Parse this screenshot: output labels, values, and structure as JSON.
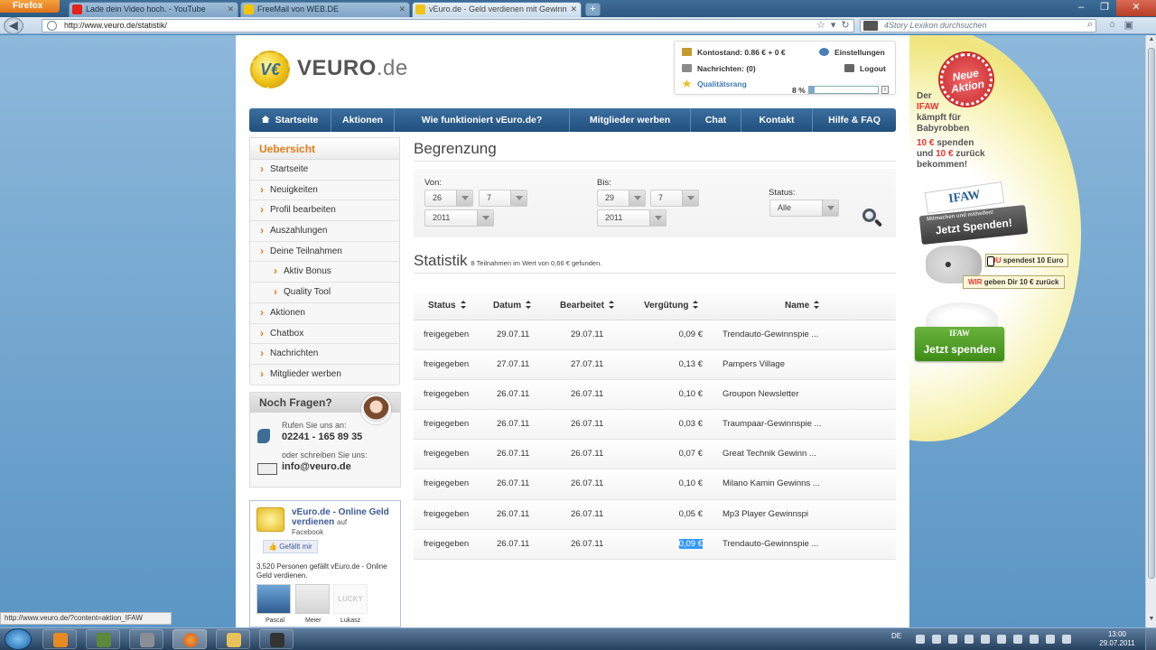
{
  "browser": {
    "app_button": "Firefox",
    "tabs": [
      {
        "label": "Lade dein Video hoch. - YouTube",
        "favicon_color": "#e62117"
      },
      {
        "label": "FreeMail von WEB.DE",
        "favicon_color": "#f5c400"
      },
      {
        "label": "vEuro.de - Geld verdienen mit Gewinn",
        "favicon_color": "#f0c418",
        "active": true
      }
    ],
    "url": "http://www.veuro.de/statistik/",
    "search_placeholder": "4Story Lexikon durchsuchen",
    "status_url": "http://www.veuro.de/?content=aktion_IFAW"
  },
  "site": {
    "logo": {
      "brand": "VEURO",
      "tld": ".de",
      "coin_letter": "V€"
    },
    "account": {
      "balance": "Kontostand: 0.86 € + 0 €",
      "messages": "Nachrichten: (0)",
      "quality_label": "Qualitätsrang",
      "quality_pct": "8 %",
      "quality_value": 0.08,
      "settings": "Einstellungen",
      "logout": "Logout"
    },
    "nav": [
      {
        "label": "Startseite",
        "icon": "home-icon"
      },
      {
        "label": "Aktionen"
      },
      {
        "label": "Wie funktioniert vEuro.de?"
      },
      {
        "label": "Mitglieder werben"
      },
      {
        "label": "Chat"
      },
      {
        "label": "Kontakt"
      },
      {
        "label": "Hilfe & FAQ"
      }
    ],
    "sidebar": {
      "title": "Uebersicht",
      "items": [
        {
          "label": "Startseite"
        },
        {
          "label": "Neuigkeiten"
        },
        {
          "label": "Profil bearbeiten"
        },
        {
          "label": "Auszahlungen"
        },
        {
          "label": "Deine Teilnahmen"
        },
        {
          "label": "Aktiv Bonus",
          "sub": true
        },
        {
          "label": "Quality Tool",
          "sub": true
        },
        {
          "label": "Aktionen"
        },
        {
          "label": "Chatbox"
        },
        {
          "label": "Nachrichten"
        },
        {
          "label": "Mitglieder werben"
        }
      ]
    },
    "help": {
      "title": "Noch Fragen?",
      "call_label": "Rufen Sie uns an:",
      "phone": "02241 - 165 89 35",
      "write_label": "oder schreiben Sie uns:",
      "email": "info@veuro.de"
    },
    "facebook": {
      "page_name": "vEuro.de - Online Geld verdienen",
      "on": "auf",
      "network": "Facebook",
      "like_button": "Gefällt mir",
      "count_text": "3,520 Personen gefällt vEuro.de - Online Geld verdienen.",
      "faces": [
        "Pascal",
        "Meier",
        "Lukasz"
      ],
      "face_overlay": "LUCKY"
    }
  },
  "filter": {
    "heading": "Begrenzung",
    "von_label": "Von:",
    "von_day": "26",
    "von_month": "7",
    "von_year": "2011",
    "bis_label": "Bis:",
    "bis_day": "29",
    "bis_month": "7",
    "bis_year": "2011",
    "status_label": "Status:",
    "status_value": "Alle"
  },
  "stats": {
    "heading": "Statistik",
    "summary": "8 Teilnahmen im Wert von 0,66 € gefunden.",
    "columns": [
      "Status",
      "Datum",
      "Bearbeitet",
      "Vergütung",
      "Name"
    ],
    "rows": [
      {
        "status": "freigegeben",
        "datum": "29.07.11",
        "bearbeitet": "29.07.11",
        "verguetung": "0,09 €",
        "name": "Trendauto-Gewinnspie ..."
      },
      {
        "status": "freigegeben",
        "datum": "27.07.11",
        "bearbeitet": "27.07.11",
        "verguetung": "0,13 €",
        "name": "Pampers Village"
      },
      {
        "status": "freigegeben",
        "datum": "26.07.11",
        "bearbeitet": "26.07.11",
        "verguetung": "0,10 €",
        "name": "Groupon Newsletter"
      },
      {
        "status": "freigegeben",
        "datum": "26.07.11",
        "bearbeitet": "26.07.11",
        "verguetung": "0,03 €",
        "name": "Traumpaar-Gewinnspie ..."
      },
      {
        "status": "freigegeben",
        "datum": "26.07.11",
        "bearbeitet": "26.07.11",
        "verguetung": "0,07 €",
        "name": "Great Technik Gewinn ..."
      },
      {
        "status": "freigegeben",
        "datum": "26.07.11",
        "bearbeitet": "26.07.11",
        "verguetung": "0,10 €",
        "name": "Milano Kamin Gewinns ..."
      },
      {
        "status": "freigegeben",
        "datum": "26.07.11",
        "bearbeitet": "26.07.11",
        "verguetung": "0,05 €",
        "name": "Mp3 Player Gewinnspi"
      },
      {
        "status": "freigegeben",
        "datum": "26.07.11",
        "bearbeitet": "26.07.11",
        "verguetung": "0,09 €",
        "name": "Trendauto-Gewinnspie ...",
        "selected": true
      }
    ]
  },
  "ad": {
    "badge": "Neue Aktion",
    "der": "Der",
    "ifaw": "IFAW",
    "line2": "kämpft für",
    "line3": "Babyrobben",
    "amount1": "10 €",
    "spenden": "spenden",
    "und": "und",
    "amount2": "10 €",
    "zurueck": "zurück",
    "bekommen": "bekommen!",
    "logo_text": "IFAW",
    "mitmachen": "Mitmachen und mithelfen!",
    "cta1": "Jetzt Spenden!",
    "bubble1_du": "DU",
    "bubble1_rest": "spendest 10 Euro",
    "bubble2_wir": "WIR",
    "bubble2_rest": "geben Dir 10 € zurück",
    "cta2_logo": "IFAW",
    "cta2": "Jetzt spenden"
  },
  "taskbar": {
    "lang": "DE",
    "time": "13:00",
    "date": "29.07.2011"
  }
}
